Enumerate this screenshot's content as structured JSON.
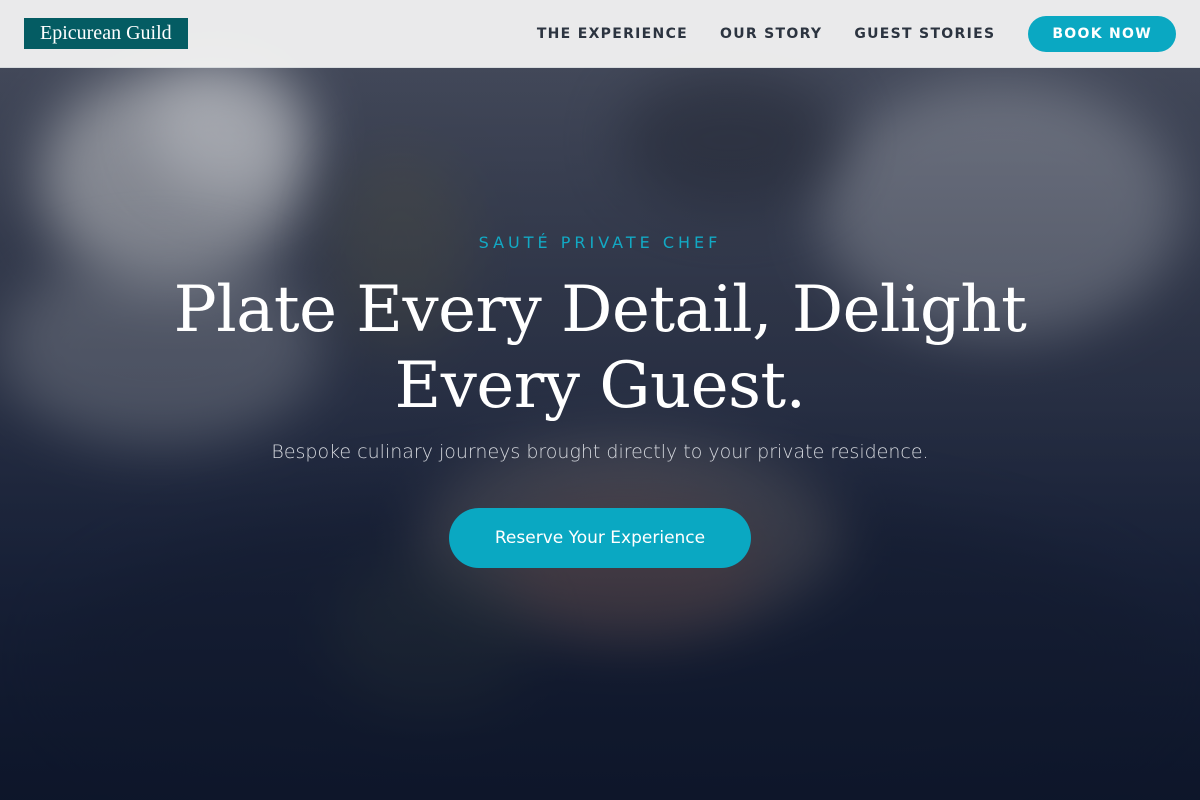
{
  "header": {
    "logo_text": "Epicurean Guild",
    "nav": [
      {
        "label": "THE EXPERIENCE"
      },
      {
        "label": "OUR STORY"
      },
      {
        "label": "GUEST STORIES"
      }
    ],
    "book_label": "BOOK NOW"
  },
  "hero": {
    "eyebrow": "SAUTÉ PRIVATE CHEF",
    "headline": "Plate Every Detail, Delight Every Guest.",
    "subtitle": "Bespoke culinary journeys brought directly to your private residence.",
    "cta_label": "Reserve Your Experience",
    "background_image": "blurred-plated-dish-photo"
  },
  "colors": {
    "accent": "#0aa8c2",
    "logo_bg": "#045c63",
    "header_bg": "#f0f0f0",
    "nav_text": "#2c3440"
  }
}
